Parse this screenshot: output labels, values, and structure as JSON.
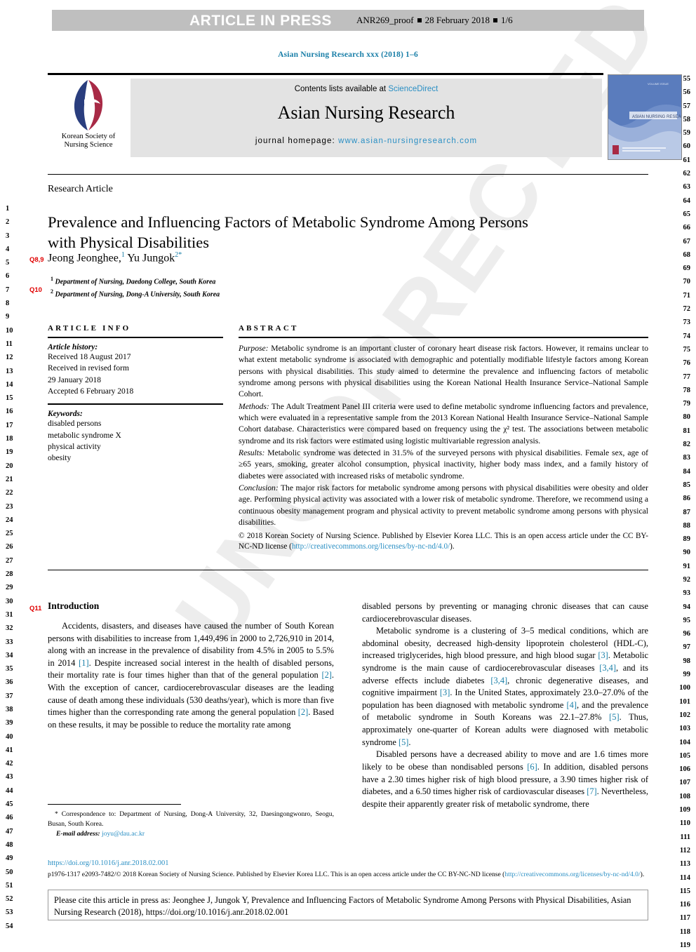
{
  "header": {
    "article_in_press": "ARTICLE IN PRESS",
    "proof_id": "ANR269_proof",
    "proof_date": "28 February 2018",
    "proof_page": "1/6",
    "running_head": "Asian Nursing Research xxx (2018) 1–6"
  },
  "masthead": {
    "contents_prefix": "Contents lists available at ",
    "sciencedirect": "ScienceDirect",
    "journal_title": "Asian Nursing Research",
    "homepage_label": "journal homepage: ",
    "homepage_url": "www.asian-nursingresearch.com",
    "society_line1": "Korean Society of",
    "society_line2": "Nursing Science",
    "cover_caption": "ASIAN NURSING RESEARCH"
  },
  "article": {
    "type_label": "Research Article",
    "title": "Prevalence and Influencing Factors of Metabolic Syndrome Among Persons with Physical Disabilities",
    "authors_plain": "Jeong Jeonghee,",
    "author1": "Jeong Jeonghee,",
    "author1_sup": "1",
    "author2": "Yu Jungok",
    "author2_sup": "2",
    "corresponding_star": "*",
    "affiliation1_sup": "1",
    "affiliation1": "Department of Nursing, Daedong College, South Korea",
    "affiliation2_sup": "2",
    "affiliation2": "Department of Nursing, Dong-A University, South Korea",
    "query_tags": {
      "authors": "Q8,9",
      "affiliations": "Q10",
      "introduction": "Q11"
    }
  },
  "article_info": {
    "heading": "ARTICLE INFO",
    "history_label": "Article history:",
    "history": [
      "Received 18 August 2017",
      "Received in revised form",
      "29 January 2018",
      "Accepted 6 February 2018"
    ],
    "keywords_label": "Keywords:",
    "keywords": [
      "disabled persons",
      "metabolic syndrome X",
      "physical activity",
      "obesity"
    ]
  },
  "abstract": {
    "heading": "ABSTRACT",
    "purpose_label": "Purpose:",
    "purpose": " Metabolic syndrome is an important cluster of coronary heart disease risk factors. However, it remains unclear to what extent metabolic syndrome is associated with demographic and potentially modifiable lifestyle factors among Korean persons with physical disabilities. This study aimed to determine the prevalence and influencing factors of metabolic syndrome among persons with physical disabilities using the Korean National Health Insurance Service–National Sample Cohort.",
    "methods_label": "Methods:",
    "methods": " The Adult Treatment Panel III criteria were used to define metabolic syndrome influencing factors and prevalence, which were evaluated in a representative sample from the 2013 Korean National Health Insurance Service–National Sample Cohort database. Characteristics were compared based on frequency using the χ² test. The associations between metabolic syndrome and its risk factors were estimated using logistic multivariable regression analysis.",
    "results_label": "Results:",
    "results": " Metabolic syndrome was detected in 31.5% of the surveyed persons with physical disabilities. Female sex, age of ≥65 years, smoking, greater alcohol consumption, physical inactivity, higher body mass index, and a family history of diabetes were associated with increased risks of metabolic syndrome.",
    "conclusion_label": "Conclusion:",
    "conclusion": " The major risk factors for metabolic syndrome among persons with physical disabilities were obesity and older age. Performing physical activity was associated with a lower risk of metabolic syndrome. Therefore, we recommend using a continuous obesity management program and physical activity to prevent metabolic syndrome among persons with physical disabilities.",
    "copyright": "© 2018 Korean Society of Nursing Science. Published by Elsevier Korea LLC. This is an open access article under the CC BY-NC-ND license (",
    "license_url": "http://creativecommons.org/licenses/by-nc-nd/4.0/",
    "copyright_end": ")."
  },
  "body": {
    "intro_heading": "Introduction",
    "left_paragraph_1": "Accidents, disasters, and diseases have caused the number of South Korean persons with disabilities to increase from 1,449,496 in 2000 to 2,726,910 in 2014, along with an increase in the prevalence of disability from 4.5% in 2005 to 5.5% in 2014 ",
    "left_p1_ref1": "[1]",
    "left_p1_cont": ". Despite increased social interest in the health of disabled persons, their mortality rate is four times higher than that of the general population ",
    "left_p1_ref2": "[2]",
    "left_p1_cont2": ". With the exception of cancer, cardiocerebrovascular diseases are the leading cause of death among these individuals (530 deaths/year), which is more than five times higher than the corresponding rate among the general population ",
    "left_p1_ref3": "[2]",
    "left_p1_cont3": ". Based on these results, it may be possible to reduce the mortality rate among",
    "right_p1_cont": "disabled persons by preventing or managing chronic diseases that can cause cardiocerebrovascular diseases.",
    "right_p2_a": "Metabolic syndrome is a clustering of 3–5 medical conditions, which are abdominal obesity, decreased high-density lipoprotein cholesterol (HDL-C), increased triglycerides, high blood pressure, and high blood sugar ",
    "right_p2_ref1": "[3]",
    "right_p2_b": ". Metabolic syndrome is the main cause of cardiocerebrovascular diseases ",
    "right_p2_ref2": "[3,4]",
    "right_p2_c": ", and its adverse effects include diabetes ",
    "right_p2_ref3": "[3,4]",
    "right_p2_d": ", chronic degenerative diseases, and cognitive impairment ",
    "right_p2_ref4": "[3]",
    "right_p2_e": ". In the United States, approximately 23.0–27.0% of the population has been diagnosed with metabolic syndrome ",
    "right_p2_ref5": "[4]",
    "right_p2_f": ", and the prevalence of metabolic syndrome in South Koreans was 22.1–27.8% ",
    "right_p2_ref6": "[5]",
    "right_p2_g": ". Thus, approximately one-quarter of Korean adults were diagnosed with metabolic syndrome ",
    "right_p2_ref7": "[5]",
    "right_p2_h": ".",
    "right_p3_a": "Disabled persons have a decreased ability to move and are 1.6 times more likely to be obese than nondisabled persons ",
    "right_p3_ref1": "[6]",
    "right_p3_b": ". In addition, disabled persons have a 2.30 times higher risk of high blood pressure, a 3.90 times higher risk of diabetes, and a 6.50 times higher risk of cardiovascular diseases ",
    "right_p3_ref2": "[7]",
    "right_p3_c": ". Nevertheless, despite their apparently greater risk of metabolic syndrome, there"
  },
  "footnote": {
    "star": "*",
    "correspondence": " Correspondence to: Department of Nursing, Dong-A University, 32, Daesingongwonro, Seogu, Busan, South Korea.",
    "email_label": "E-mail address:",
    "email": "joyu@dau.ac.kr",
    "doi": "https://doi.org/10.1016/j.anr.2018.02.001",
    "issn_line": "p1976-1317 e2093-7482/© 2018 Korean Society of Nursing Science. Published by Elsevier Korea LLC. This is an open access article under the CC BY-NC-ND license (",
    "issn_url": "http://creativecommons.org/licenses/by-nc-nd/4.0/",
    "issn_end": ")."
  },
  "cite_box": {
    "text": "Please cite this article in press as: Jeonghee J, Jungok Y, Prevalence and Influencing Factors of Metabolic Syndrome Among Persons with Physical Disabilities, Asian Nursing Research (2018), https://doi.org/10.1016/j.anr.2018.02.001"
  },
  "line_numbers": {
    "left_start": 1,
    "left_end": 54,
    "right_start": 55,
    "right_end": 119
  },
  "watermark": {
    "text": "UNCORRECTED PROOF"
  },
  "colors": {
    "link": "#2a8fc4",
    "reference": "#1a7fa8",
    "query_tag": "#e00000",
    "banner_bg": "#bfbfbf",
    "masthead_bg": "#e3e3e3"
  }
}
